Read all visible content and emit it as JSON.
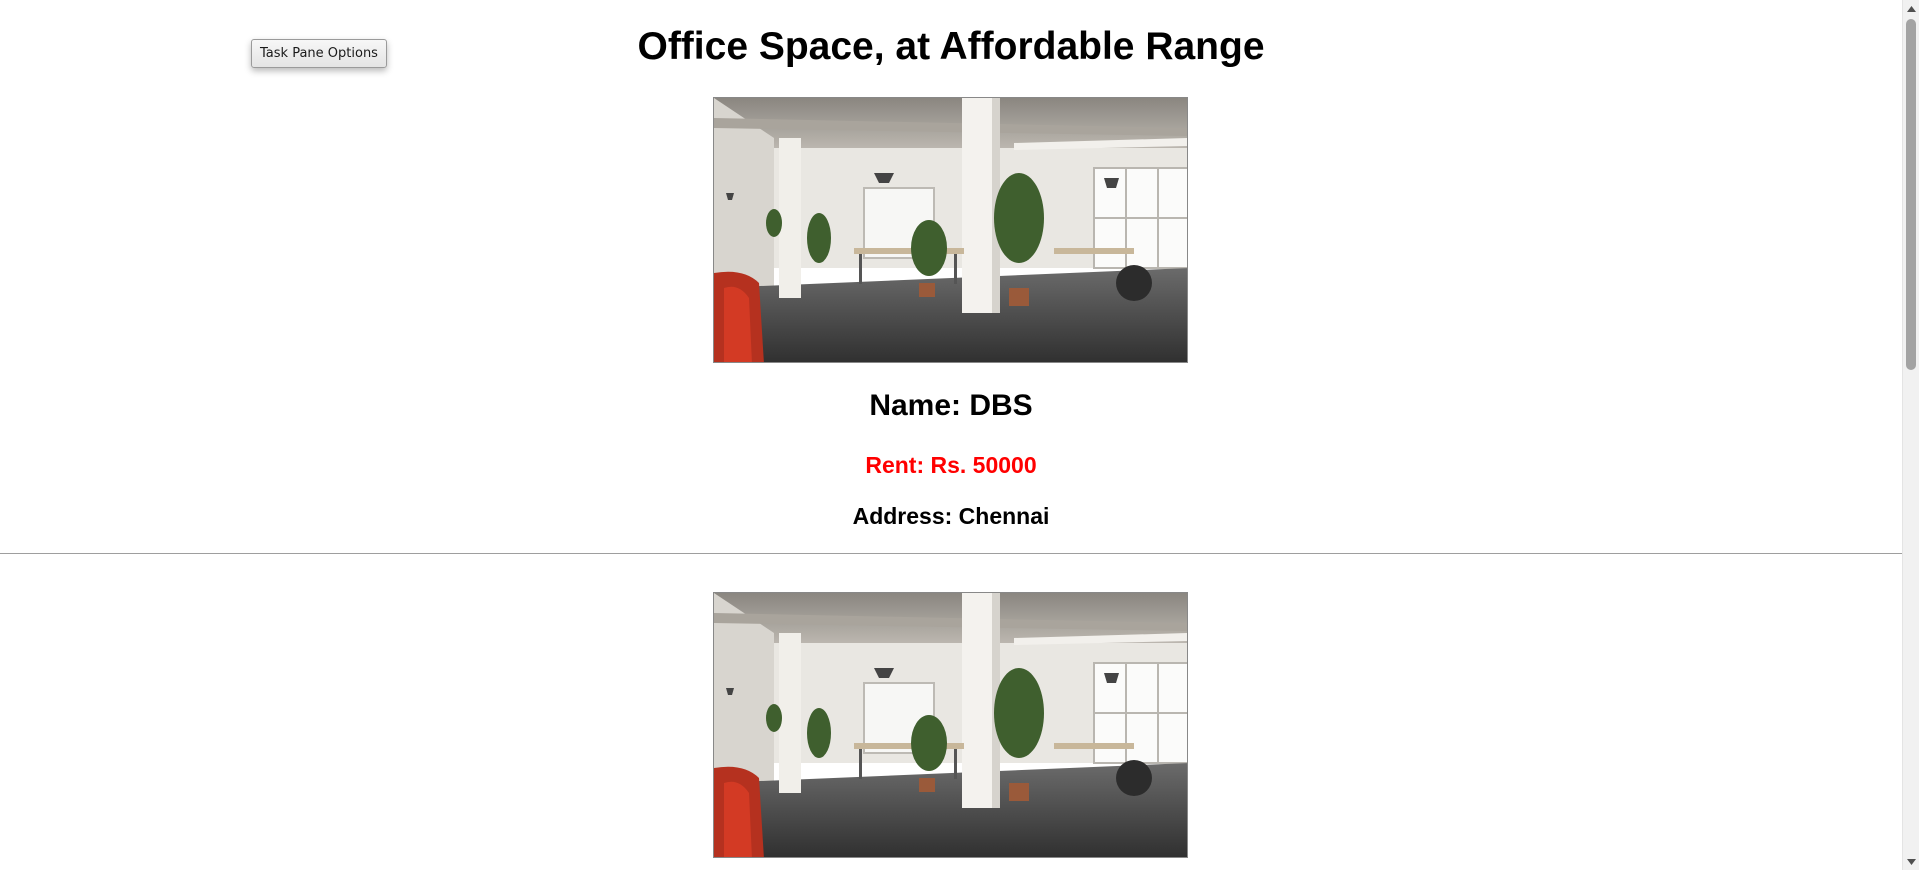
{
  "app": {
    "task_pane_button_label": "Task Pane Options",
    "page_title": "Office Space, at Affordable Range"
  },
  "listings": [
    {
      "name": "Name: DBS",
      "rent": "Rent: Rs. 50000",
      "address": "Address: Chennai",
      "image": "office-interior-photo"
    },
    {
      "image": "office-interior-photo"
    }
  ],
  "colors": {
    "rent_text": "#ff0000",
    "heading_text": "#000000",
    "divider": "#9e9e9e",
    "scrollbar_thumb": "#a3a3a3"
  },
  "icons": {
    "scroll_up": "triangle-up-icon",
    "scroll_down": "triangle-down-icon"
  }
}
